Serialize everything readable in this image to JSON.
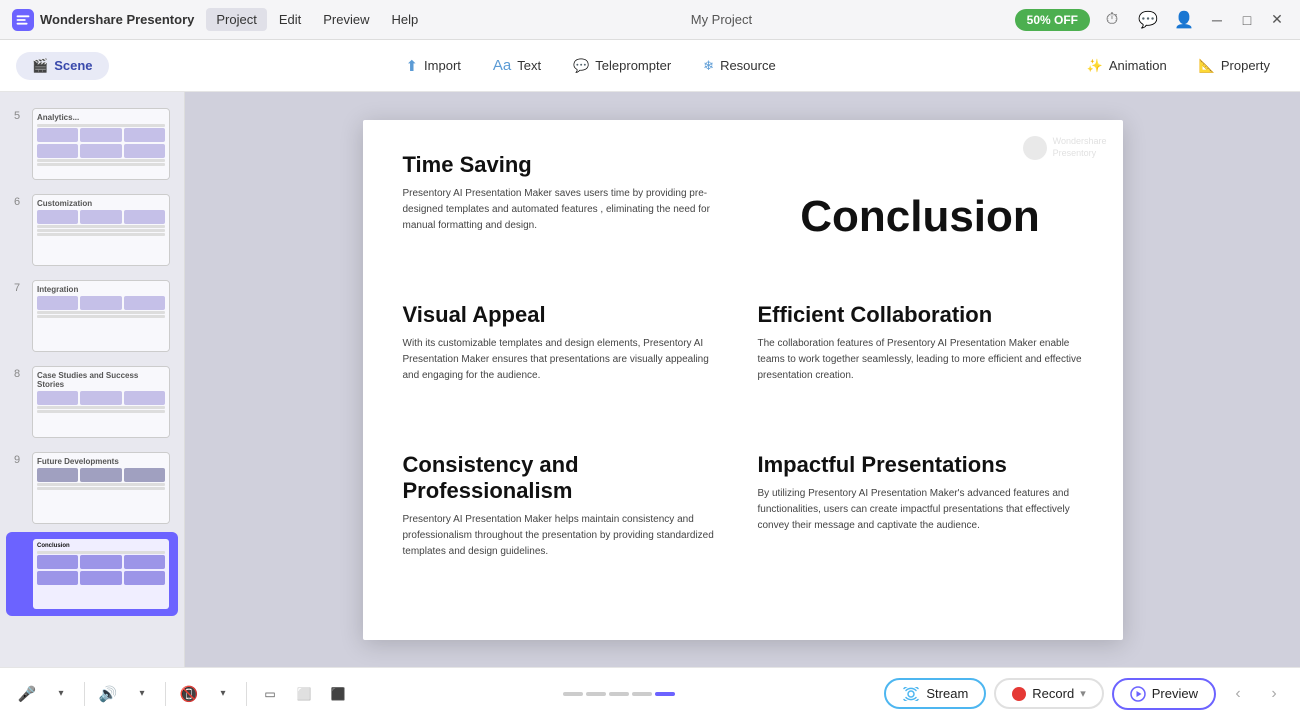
{
  "app": {
    "name": "Wondershare Presentory",
    "project_name": "My Project"
  },
  "titlebar": {
    "menu_items": [
      "Project",
      "Edit",
      "Preview",
      "Help"
    ],
    "active_menu": "Project",
    "promo_label": "50% OFF",
    "window_controls": [
      "minimize",
      "maximize",
      "close"
    ]
  },
  "toolbar": {
    "scene_label": "Scene",
    "items": [
      {
        "id": "import",
        "label": "Import"
      },
      {
        "id": "text",
        "label": "Text"
      },
      {
        "id": "teleprompter",
        "label": "Teleprompter"
      },
      {
        "id": "resource",
        "label": "Resource"
      },
      {
        "id": "animation",
        "label": "Animation"
      },
      {
        "id": "property",
        "label": "Property"
      }
    ]
  },
  "sidebar": {
    "slides": [
      {
        "number": "5",
        "label": "Analytics..."
      },
      {
        "number": "6",
        "label": "Customization"
      },
      {
        "number": "7",
        "label": "Integration"
      },
      {
        "number": "8",
        "label": "Case Studies and Success Stories"
      },
      {
        "number": "9",
        "label": "Future Developments"
      },
      {
        "number": "",
        "label": "Conclusion",
        "active": true
      }
    ]
  },
  "canvas": {
    "watermark": "Wondershare\nPresentory",
    "conclusion_title": "Conclusion",
    "sections": [
      {
        "id": "time-saving",
        "title": "Time Saving",
        "body": "Presentory AI Presentation Maker saves users time by providing pre-designed templates and automated features , eliminating the need for manual formatting and design."
      },
      {
        "id": "visual-appeal",
        "title": "Visual Appeal",
        "body": "With its customizable templates and design elements, Presentory AI Presentation Maker ensures that presentations are visually appealing and engaging for the audience."
      },
      {
        "id": "consistency-professionalism",
        "title": "Consistency and Professionalism",
        "body": "Presentory AI Presentation Maker helps maintain consistency and professionalism throughout the presentation by providing standardized templates and design guidelines."
      },
      {
        "id": "efficient-collaboration",
        "title": "Efficient Collaboration",
        "body": "The collaboration features of Presentory AI Presentation Maker enable teams to work together seamlessly, leading to more efficient and effective presentation creation."
      },
      {
        "id": "impactful-presentations",
        "title": "Impactful Presentations",
        "body": "By utilizing Presentory AI Presentation Maker's advanced features and functionalities, users can create impactful presentations that effectively convey their message and captivate the audience."
      }
    ]
  },
  "bottom_bar": {
    "stream_label": "Stream",
    "record_label": "Record",
    "preview_label": "Preview"
  }
}
